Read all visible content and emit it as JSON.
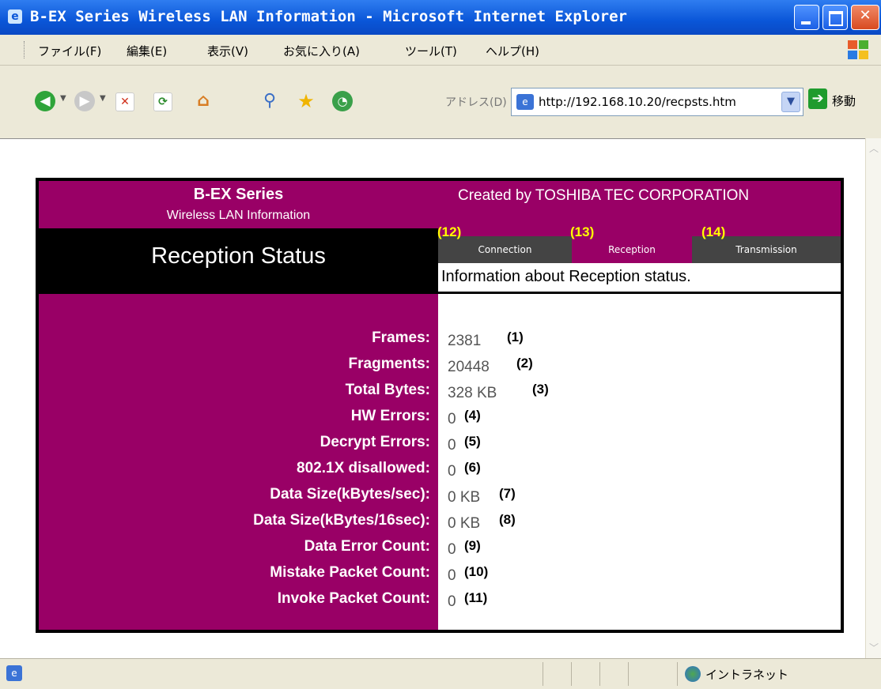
{
  "window": {
    "title": "B-EX Series Wireless LAN Information - Microsoft Internet Explorer"
  },
  "menu": [
    "ファイル(F)",
    "編集(E)",
    "表示(V)",
    "お気に入り(A)",
    "ツール(T)",
    "ヘルプ(H)"
  ],
  "toolbar": {
    "address_label": "アドレス(D)",
    "url": "http://192.168.10.20/recpsts.htm",
    "go_label": "移動"
  },
  "statusbar": {
    "zone": "イントラネット"
  },
  "page": {
    "series": "B-EX Series",
    "subtitle": "Wireless LAN Information",
    "created_by": "Created by TOSHIBA TEC CORPORATION",
    "title": "Reception Status",
    "info": "Information about Reception status.",
    "tabs": [
      {
        "label": "Connection",
        "marker": "(12)",
        "active": false
      },
      {
        "label": "Reception",
        "marker": "(13)",
        "active": true
      },
      {
        "label": "Transmission",
        "marker": "(14)",
        "active": false
      }
    ],
    "stats": [
      {
        "label": "Frames:",
        "value": "2381",
        "marker": "(1)"
      },
      {
        "label": "Fragments:",
        "value": "20448",
        "marker": "(2)"
      },
      {
        "label": "Total Bytes:",
        "value": "328 KB",
        "marker": "(3)"
      },
      {
        "label": "HW Errors:",
        "value": "0",
        "marker": "(4)"
      },
      {
        "label": "Decrypt Errors:",
        "value": "0",
        "marker": "(5)"
      },
      {
        "label": "802.1X disallowed:",
        "value": "0",
        "marker": "(6)"
      },
      {
        "label": "Data Size(kBytes/sec):",
        "value": "0 KB",
        "marker": "(7)"
      },
      {
        "label": "Data Size(kBytes/16sec):",
        "value": "0 KB",
        "marker": "(8)"
      },
      {
        "label": "Data Error Count:",
        "value": "0",
        "marker": "(9)"
      },
      {
        "label": "Mistake Packet Count:",
        "value": "0",
        "marker": "(10)"
      },
      {
        "label": "Invoke Packet Count:",
        "value": "0",
        "marker": "(11)"
      }
    ]
  },
  "colors": {
    "brand": "#990066",
    "marker": "#ffff00",
    "titlebar": "#0a56d8"
  },
  "icons": [
    "ie-icon",
    "back-icon",
    "forward-icon",
    "stop-icon",
    "refresh-icon",
    "home-icon",
    "search-icon",
    "favorites-icon",
    "history-icon",
    "page-icon",
    "go-icon",
    "intranet-icon",
    "windows-logo-icon"
  ]
}
